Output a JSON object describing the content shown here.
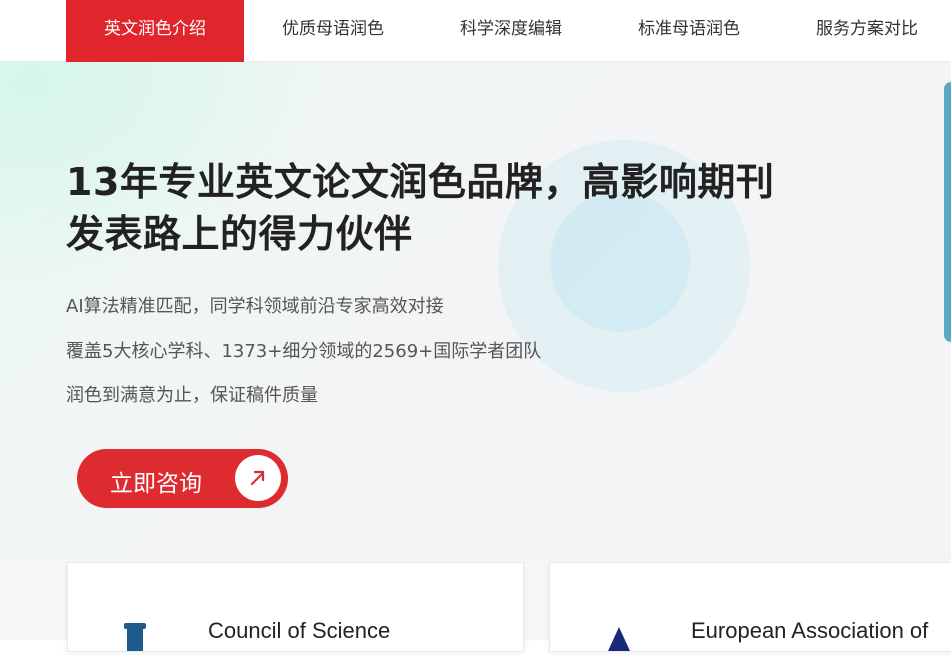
{
  "nav": {
    "items": [
      {
        "label": "英文润色介绍",
        "active": true
      },
      {
        "label": "优质母语润色",
        "active": false
      },
      {
        "label": "科学深度编辑",
        "active": false
      },
      {
        "label": "标准母语润色",
        "active": false
      },
      {
        "label": "服务方案对比",
        "active": false
      }
    ]
  },
  "hero": {
    "title_line1": "13年专业英文论文润色品牌，高影响期刊",
    "title_line2": "发表路上的得力伙伴",
    "lines": [
      "AI算法精准匹配，同学科领域前沿专家高效对接",
      "覆盖5大核心学科、1373+细分领域的2569+国际学者团队",
      "润色到满意为止，保证稿件质量"
    ],
    "cta_label": "立即咨询",
    "cta_icon": "arrow-up-right-icon"
  },
  "cards": [
    {
      "title": "Council of Science",
      "icon": "council-logo-icon"
    },
    {
      "title": "European Association of",
      "icon": "eurasian-logo-icon"
    }
  ],
  "colors": {
    "accent": "#e0262c",
    "text": "#222222",
    "muted": "#555555"
  }
}
